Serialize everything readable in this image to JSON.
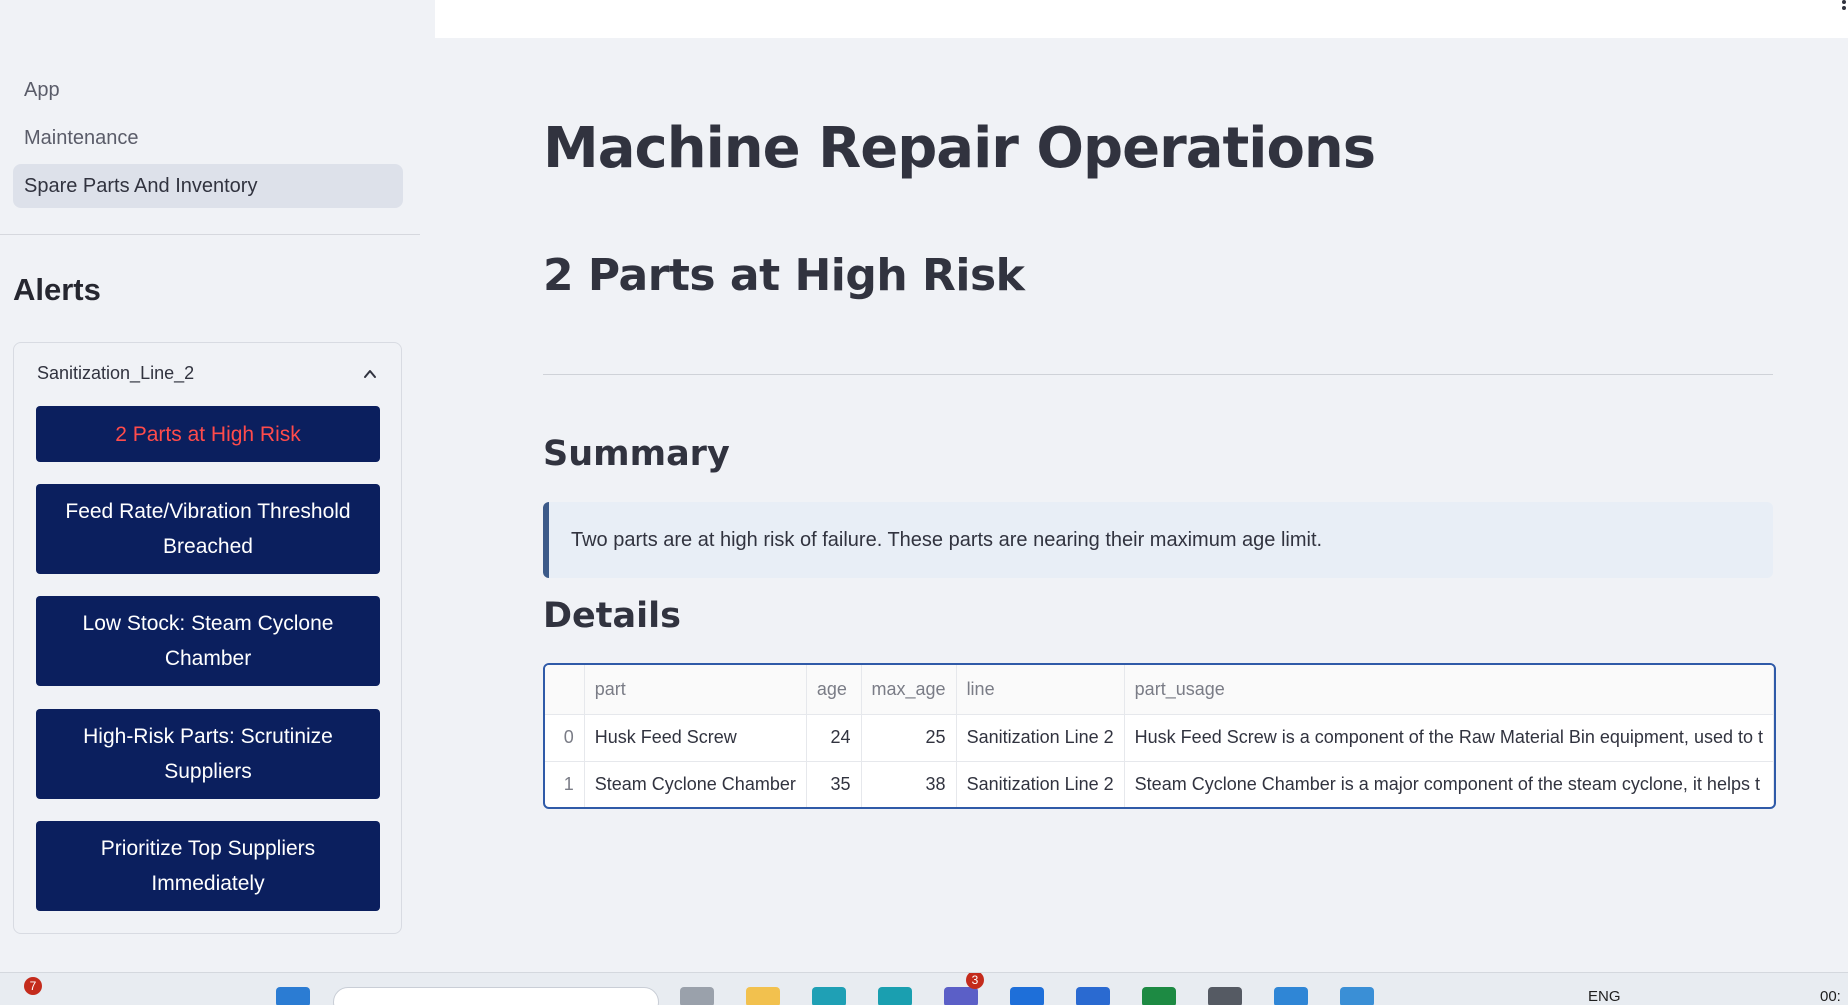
{
  "sidebar": {
    "nav": [
      {
        "label": "App"
      },
      {
        "label": "Maintenance"
      },
      {
        "label": "Spare Parts And Inventory"
      }
    ],
    "alerts_title": "Alerts",
    "expander": {
      "title": "Sanitization_Line_2",
      "buttons": [
        {
          "label": "2 Parts at High Risk"
        },
        {
          "label": "Feed Rate/Vibration Threshold Breached"
        },
        {
          "label": "Low Stock: Steam Cyclone Chamber"
        },
        {
          "label": "High-Risk Parts: Scrutinize Suppliers"
        },
        {
          "label": "Prioritize Top Suppliers Immediately"
        }
      ]
    }
  },
  "main": {
    "title": "Machine Repair Operations",
    "subtitle": "2 Parts at High Risk",
    "summary_heading": "Summary",
    "summary_text": "Two parts are at high risk of failure. These parts are nearing their maximum age limit.",
    "details_heading": "Details",
    "table": {
      "columns": [
        "",
        "part",
        "age",
        "max_age",
        "line",
        "part_usage"
      ],
      "rows": [
        {
          "index": "0",
          "part": "Husk Feed Screw",
          "age": "24",
          "max_age": "25",
          "line": "Sanitization Line 2",
          "part_usage": "Husk Feed Screw is a component of the Raw Material Bin equipment, used to t"
        },
        {
          "index": "1",
          "part": "Steam Cyclone Chamber",
          "age": "35",
          "max_age": "38",
          "line": "Sanitization Line 2",
          "part_usage": "Steam Cyclone Chamber is a major component of the steam cyclone, it helps t"
        }
      ]
    }
  },
  "taskbar": {
    "notification_count": "7",
    "teams_badge": "3",
    "language": "ENG",
    "clock": "00:"
  },
  "colors": {
    "alert_button_bg": "#0b1f5e",
    "highlight_text": "#ff4b4b",
    "table_border": "#2f5aa8",
    "info_border": "#3c5a89"
  }
}
